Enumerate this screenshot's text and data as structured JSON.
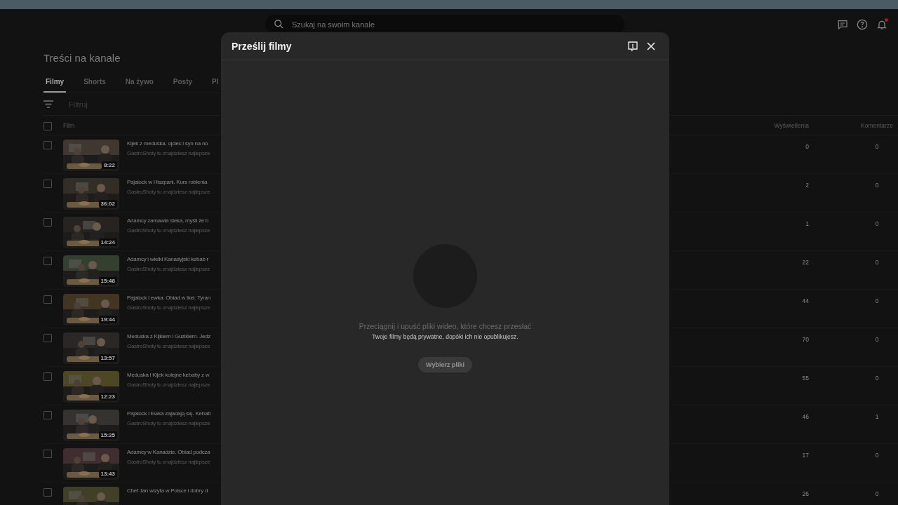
{
  "search": {
    "placeholder": "Szukaj na swoim kanale"
  },
  "page_title": "Treści na kanale",
  "tabs": [
    {
      "label": "Filmy",
      "selected": true
    },
    {
      "label": "Shorts",
      "selected": false
    },
    {
      "label": "Na żywo",
      "selected": false
    },
    {
      "label": "Posty",
      "selected": false
    },
    {
      "label": "Pl",
      "selected": false
    }
  ],
  "filter": {
    "placeholder": "Filtruj"
  },
  "table": {
    "select_all": {
      "checked": false
    },
    "columns": [
      "Film",
      "Wyświetlenia",
      "Komentarze"
    ],
    "rows": [
      {
        "title": "Kijek z meduska. ojciec i syn na no",
        "description": "GastroShoty tu znajdziesz najlepsze",
        "duration": "8:22",
        "views": "0",
        "comments": "0",
        "checked": false
      },
      {
        "title": "Pajalock w Hiszpani. Kurs robienia",
        "description": "GastroShoty tu znajdziesz najlepsze",
        "duration": "36:02",
        "views": "2",
        "comments": "0",
        "checked": false
      },
      {
        "title": "Adamcy zamawia steka, myśli że b",
        "description": "GastroShoty tu znajdziesz najlepsze",
        "duration": "14:24",
        "views": "1",
        "comments": "0",
        "checked": false
      },
      {
        "title": "Adamcy i wielki Kanadyjski kebab r",
        "description": "GastroShoty tu znajdziesz najlepsze",
        "duration": "15:48",
        "views": "22",
        "comments": "0",
        "checked": false
      },
      {
        "title": "Pajalock i ewka. Obiad w Ikei. Tyran",
        "description": "GastroShoty tu znajdziesz najlepsze",
        "duration": "19:44",
        "views": "44",
        "comments": "0",
        "checked": false
      },
      {
        "title": "Meduska z Kijkiem i Guzikiem. Jedz",
        "description": "GastroShoty tu znajdziesz najlepsze",
        "duration": "13:57",
        "views": "70",
        "comments": "0",
        "checked": false
      },
      {
        "title": "Meduska i Kijek kolejne kebaby z w",
        "description": "GastroShoty tu znajdziesz najlepsze",
        "duration": "12:23",
        "views": "55",
        "comments": "0",
        "checked": false
      },
      {
        "title": "Pajalock i Ewka zajadają się. Kebab",
        "description": "GastroShoty tu znajdziesz najlepsze",
        "duration": "15:25",
        "views": "46",
        "comments": "1",
        "checked": false
      },
      {
        "title": "Adamcy w Kanadzie. Obiad podcza",
        "description": "GastroShoty tu znajdziesz najlepsze",
        "duration": "13:43",
        "views": "17",
        "comments": "0",
        "checked": false
      },
      {
        "title": "Chef Jan wizyta w Polsce i dobry d",
        "views": "26",
        "comments": "0",
        "checked": false
      }
    ]
  },
  "dialog": {
    "title": "Prześlij filmy",
    "drop_text": "Przeciągnij i upuść pliki wideo, które chcesz przesłać",
    "privacy_text": "Twoje filmy będą prywatne, dopóki ich nie opublikujesz.",
    "button": "Wybierz pliki"
  }
}
